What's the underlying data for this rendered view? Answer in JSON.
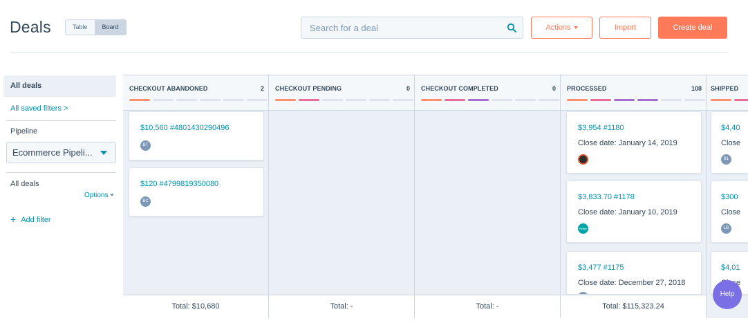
{
  "header": {
    "title": "Deals",
    "view_table": "Table",
    "view_board": "Board",
    "search_placeholder": "Search for a deal",
    "actions_label": "Actions",
    "import_label": "Import",
    "create_label": "Create deal"
  },
  "sidebar": {
    "all_deals": "All deals",
    "saved_filters": "All saved filters >",
    "pipeline_label": "Pipeline",
    "pipeline_value": "Ecommerce Pipeli...",
    "filter_title": "All deals",
    "options_label": "Options",
    "add_filter": "Add filter"
  },
  "columns": [
    {
      "name": "CHECKOUT ABANDONED",
      "count": "2",
      "progress_filled": 1,
      "total": "Total: $10,680",
      "cards": [
        {
          "title": "$10,560 #4801430290496",
          "close": "",
          "avatar": "BT"
        },
        {
          "title": "$120 #4799819350080",
          "close": "",
          "avatar": "BC"
        }
      ]
    },
    {
      "name": "CHECKOUT PENDING",
      "count": "0",
      "progress_filled": 2,
      "total": "Total: -",
      "cards": []
    },
    {
      "name": "CHECKOUT COMPLETED",
      "count": "0",
      "progress_filled": 3,
      "total": "Total: -",
      "cards": []
    },
    {
      "name": "PROCESSED",
      "count": "108",
      "progress_filled": 4,
      "total": "Total: $115,323.24",
      "cards": [
        {
          "title": "$3,954 #1180",
          "close": "Close date: January 14, 2019",
          "avatar": ""
        },
        {
          "title": "$3,833.70 #1178",
          "close": "Close date: January 10, 2019",
          "avatar": "Reflex"
        },
        {
          "title": "$3,477 #1175",
          "close": "Close date: December 27, 2018",
          "avatar": ""
        }
      ]
    },
    {
      "name": "SHIPPED",
      "count": "",
      "progress_filled": 5,
      "total": "",
      "cards": [
        {
          "title": "$4,40",
          "close": "Close",
          "avatar": "B1"
        },
        {
          "title": "$300",
          "close": "Close",
          "avatar": "LB"
        },
        {
          "title": "$4,01",
          "close": "Close",
          "avatar": ""
        }
      ]
    }
  ],
  "help_label": "Help",
  "colors": {
    "accent": "#ff7a59",
    "link": "#0091ae",
    "stage_colors": [
      "#ff8f73",
      "#e66e98",
      "#a66ecd",
      "#a66ecd",
      "#ff8f73"
    ]
  }
}
